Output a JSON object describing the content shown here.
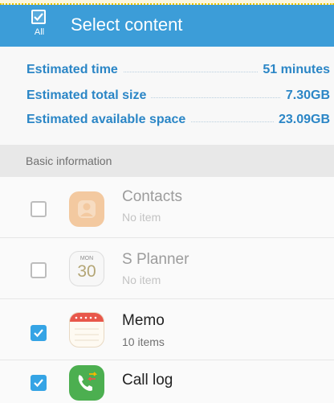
{
  "appbar": {
    "select_all_label": "All",
    "title": "Select content"
  },
  "estimates": [
    {
      "label": "Estimated time",
      "value": "51 minutes"
    },
    {
      "label": "Estimated total size",
      "value": "7.30GB"
    },
    {
      "label": "Estimated available space",
      "value": "23.09GB"
    }
  ],
  "section": {
    "title": "Basic information"
  },
  "items": [
    {
      "name": "Contacts",
      "sub": "No item",
      "checked": false,
      "enabled": false,
      "icon": "contacts-icon"
    },
    {
      "name": "S Planner",
      "sub": "No item",
      "checked": false,
      "enabled": false,
      "icon": "calendar-icon",
      "icon_month": "MON",
      "icon_day": "30"
    },
    {
      "name": "Memo",
      "sub": "10 items",
      "checked": true,
      "enabled": true,
      "icon": "memo-icon"
    },
    {
      "name": "Call log",
      "sub": "",
      "checked": true,
      "enabled": true,
      "icon": "call-log-icon"
    }
  ],
  "colors": {
    "appbar": "#3c9dd8",
    "accent_text": "#2b86c6",
    "checkbox_checked": "#35a4e5"
  }
}
